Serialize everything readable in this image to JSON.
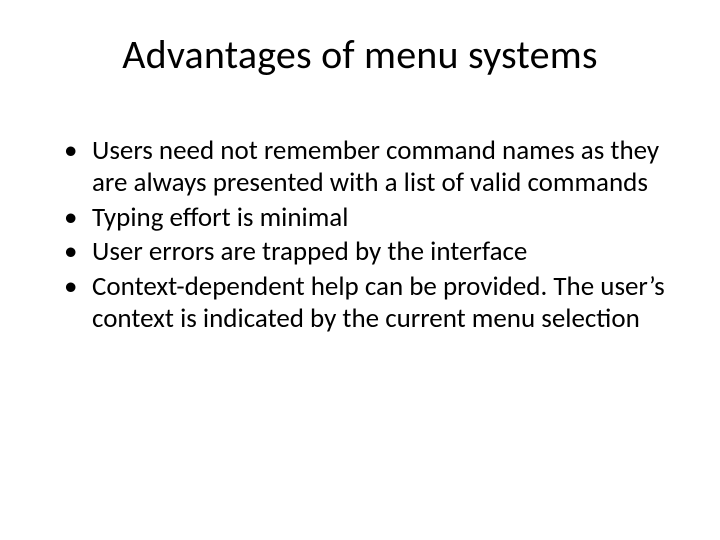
{
  "title": "Advantages of menu systems",
  "bullets": {
    "items": [
      "Users need not remember command names as they are always presented with a list of valid commands",
      "Typing effort is minimal",
      "User errors are trapped by the interface",
      "Context-dependent help can be provided. The user’s context is indicated by the current menu selection"
    ]
  }
}
